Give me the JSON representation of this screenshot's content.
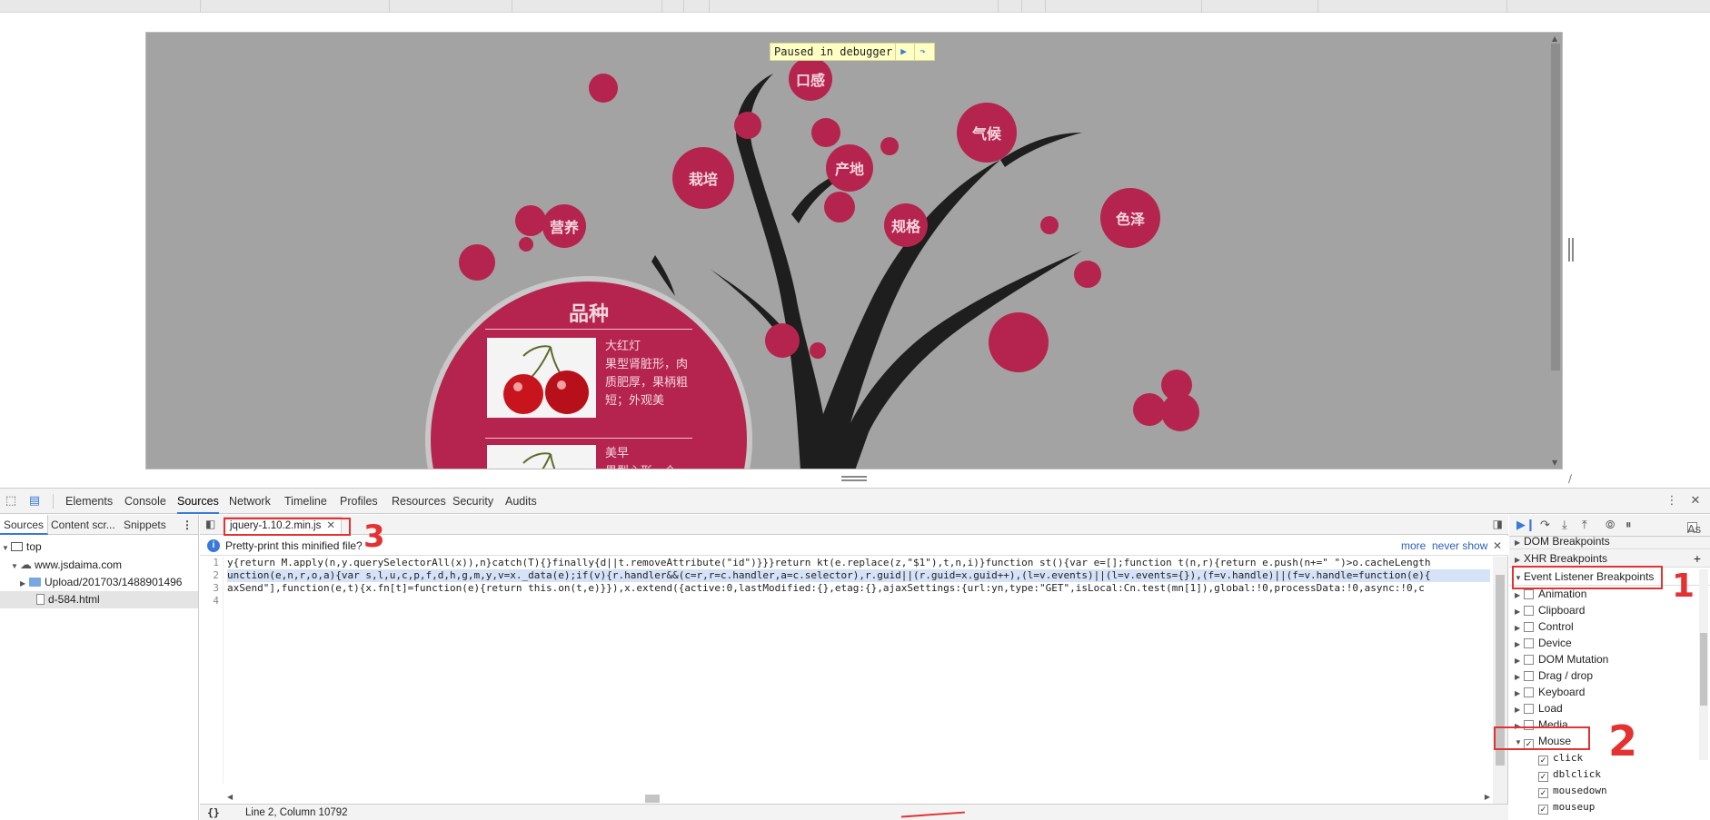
{
  "page": {
    "debugger_banner": "Paused in debugger",
    "resume_icon": "resume-icon",
    "stepover_icon": "step-over-icon"
  },
  "scene": {
    "bubbles": [
      "口感",
      "气候",
      "产地",
      "栽培",
      "营养",
      "规格",
      "色泽"
    ],
    "card_title": "品种",
    "cards": [
      {
        "name": "大红灯",
        "desc": "果型肾脏形，肉质肥厚，果柄粗短；外观美"
      },
      {
        "name": "美早",
        "desc": "果型心形，个"
      }
    ],
    "colors": {
      "bubble": "#b5244e",
      "background": "#a3a3a3",
      "branch": "#1e1e1e"
    }
  },
  "devtools": {
    "main_tabs": [
      "Elements",
      "Console",
      "Sources",
      "Network",
      "Timeline",
      "Profiles",
      "Resources",
      "Security",
      "Audits"
    ],
    "active_tab": "Sources",
    "nav_tabs": [
      "Sources",
      "Content scr...",
      "Snippets"
    ],
    "tree": {
      "top": "top",
      "domain": "www.jsdaima.com",
      "folder": "Upload/201703/1488901496",
      "file": "d-584.html"
    },
    "file_tab": "jquery-1.10.2.min.js",
    "infobar": {
      "message": "Pretty-print this minified file?",
      "more": "more",
      "never": "never show"
    },
    "gutter": [
      "1",
      "2",
      "3",
      "4"
    ],
    "code_lines": [
      "y{return M.apply(n,y.querySelectorAll(x)),n}catch(T){}finally{d||t.removeAttribute(\"id\")}}}return kt(e.replace(z,\"$1\"),t,n,i)}function st(){var e=[];function t(n,r){return e.push(n+=\" \")>o.cacheLength",
      "unction(e,n,r,o,a){var s,l,u,c,p,f,d,h,g,m,y,v=x._data(e);if(v){r.handler&&(c=r,r=c.handler,a=c.selector),r.guid||(r.guid=x.guid++),(l=v.events)||(l=v.events={}),(f=v.handle)||(f=v.handle=function(e){",
      "axSend\"],function(e,t){x.fn[t]=function(e){return this.on(t,e)}}),x.extend({active:0,lastModified:{},etag:{},ajaxSettings:{url:yn,type:\"GET\",isLocal:Cn.test(mn[1]),global:!0,processData:!0,async:!0,c",
      ""
    ],
    "status": "Line 2, Column 10792",
    "sections": {
      "dom": "DOM Breakpoints",
      "xhr": "XHR Breakpoints",
      "event": "Event Listener Breakpoints"
    },
    "events": [
      {
        "label": "Animation",
        "checked": false
      },
      {
        "label": "Clipboard",
        "checked": false
      },
      {
        "label": "Control",
        "checked": false
      },
      {
        "label": "Device",
        "checked": false
      },
      {
        "label": "DOM Mutation",
        "checked": false
      },
      {
        "label": "Drag / drop",
        "checked": false
      },
      {
        "label": "Keyboard",
        "checked": false
      },
      {
        "label": "Load",
        "checked": false
      },
      {
        "label": "Media",
        "checked": false
      },
      {
        "label": "Mouse",
        "checked": true
      }
    ],
    "mouse_events": [
      "click",
      "dblclick",
      "mousedown",
      "mouseup"
    ],
    "async_label": "As"
  },
  "annotations": [
    "1",
    "2",
    "3"
  ],
  "accent": "#3879d9",
  "annotation_color": "#e43232"
}
